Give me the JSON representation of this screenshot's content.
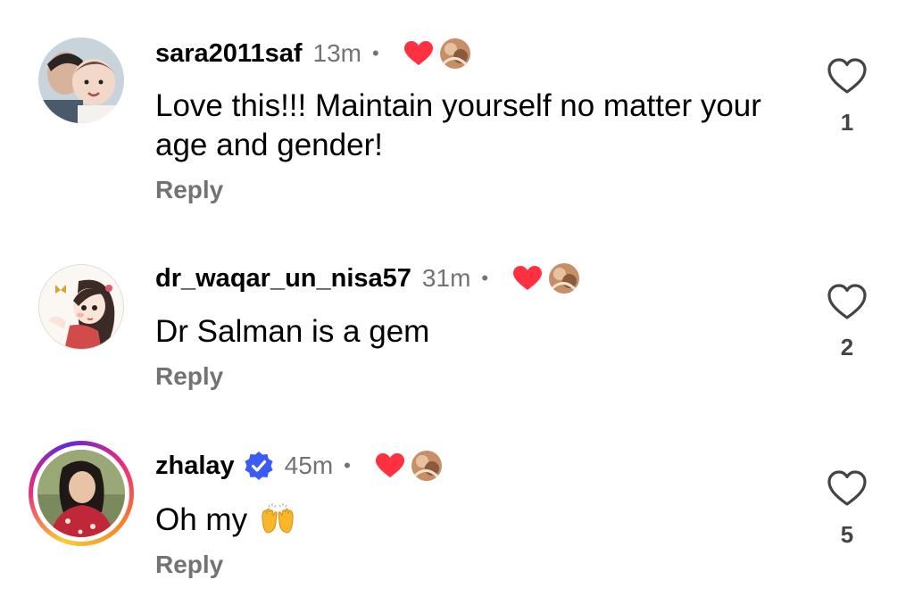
{
  "comments": [
    {
      "username": "sara2011saf",
      "time": "13m",
      "separator": "•",
      "text": "Love this!!! Maintain yourself no matter your age and gender!",
      "reply_label": "Reply",
      "like_count": "1",
      "liked_by_author": true,
      "verified": false
    },
    {
      "username": "dr_waqar_un_nisa57",
      "time": "31m",
      "separator": "•",
      "text": "Dr Salman is a gem",
      "reply_label": "Reply",
      "like_count": "2",
      "liked_by_author": true,
      "verified": false
    },
    {
      "username": "zhalay",
      "time": "45m",
      "separator": "•",
      "text": "Oh my",
      "emoji": "raising-hands",
      "reply_label": "Reply",
      "like_count": "5",
      "liked_by_author": true,
      "verified": true,
      "has_story_ring": true
    }
  ],
  "colors": {
    "heart_red": "#ff3040",
    "meta_gray": "#737373",
    "verified_blue": "#3b5bf6"
  }
}
